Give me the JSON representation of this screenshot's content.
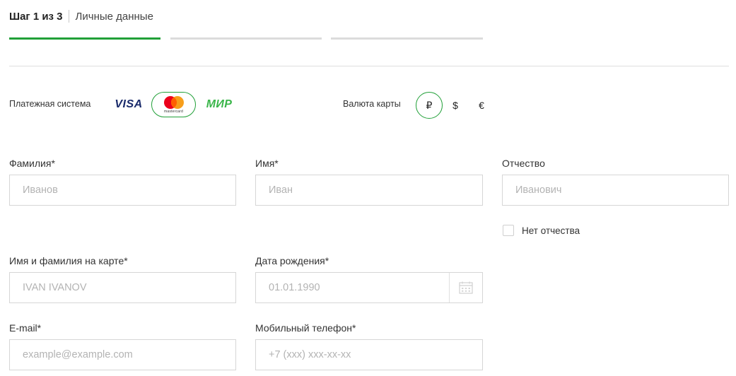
{
  "steps": {
    "current": "Шаг 1 из 3",
    "name": "Личные данные",
    "count": 3,
    "active_index": 1,
    "accent": "#21a038"
  },
  "payment": {
    "label": "Платежная система",
    "options": [
      {
        "id": "visa",
        "label": "VISA",
        "selected": false
      },
      {
        "id": "mastercard",
        "label": "mastercard",
        "selected": true
      },
      {
        "id": "mir",
        "label": "МИР",
        "selected": false
      }
    ]
  },
  "currency": {
    "label": "Валюта карты",
    "options": [
      {
        "symbol": "₽",
        "selected": true
      },
      {
        "symbol": "$",
        "selected": false
      },
      {
        "symbol": "€",
        "selected": false
      }
    ]
  },
  "form": {
    "last_name": {
      "label": "Фамилия*",
      "placeholder": "Иванов",
      "value": ""
    },
    "first_name": {
      "label": "Имя*",
      "placeholder": "Иван",
      "value": ""
    },
    "middle_name": {
      "label": "Отчество",
      "placeholder": "Иванович",
      "value": ""
    },
    "no_middle_name": {
      "label": "Нет отчества",
      "checked": false
    },
    "card_name": {
      "label": "Имя и фамилия на карте*",
      "placeholder": "IVAN IVANOV",
      "value": ""
    },
    "birth_date": {
      "label": "Дата рождения*",
      "placeholder": "01.01.1990",
      "value": "",
      "icon": "calendar-icon"
    },
    "email": {
      "label": "E-mail*",
      "placeholder": "example@example.com",
      "value": ""
    },
    "phone": {
      "label": "Мобильный телефон*",
      "placeholder": "+7 (xxx) xxx-xx-xx",
      "value": ""
    }
  }
}
